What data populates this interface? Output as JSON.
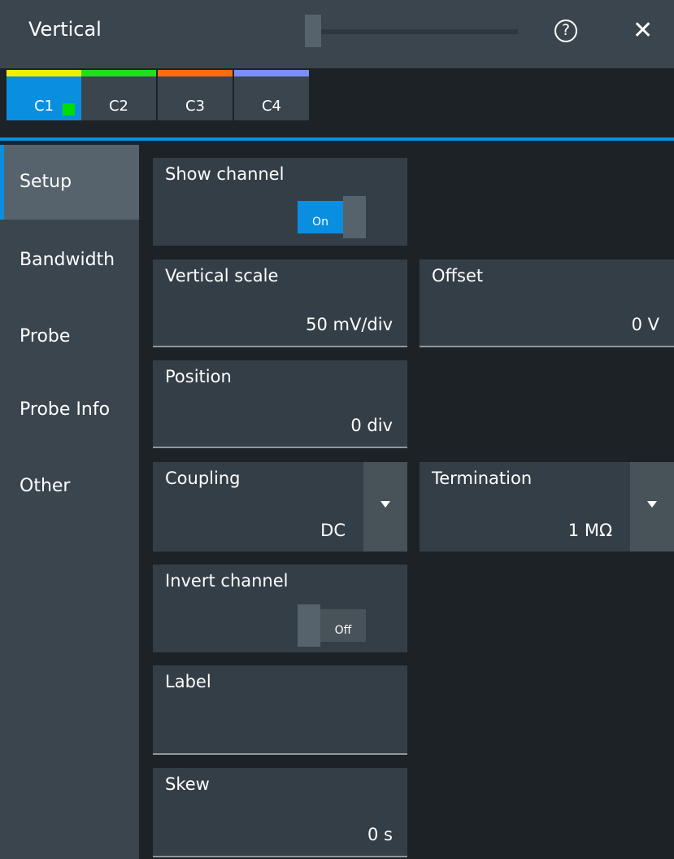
{
  "window": {
    "title": "Vertical",
    "help_glyph": "?",
    "close_glyph": "✕"
  },
  "tabs": [
    {
      "label": "C1",
      "color": "#f2ee00",
      "active": true
    },
    {
      "label": "C2",
      "color": "#22dd22"
    },
    {
      "label": "C3",
      "color": "#ff6a13"
    },
    {
      "label": "C4",
      "color": "#7a8fff"
    }
  ],
  "sidebar": {
    "items": [
      {
        "label": "Setup"
      },
      {
        "label": "Bandwidth"
      },
      {
        "label": "Probe"
      },
      {
        "label": "Probe Info"
      },
      {
        "label": "Other"
      }
    ]
  },
  "settings": {
    "show_channel": {
      "label": "Show channel",
      "state": "On"
    },
    "vertical_scale": {
      "label": "Vertical scale",
      "value": "50 mV/div"
    },
    "offset": {
      "label": "Offset",
      "value": "0 V"
    },
    "position": {
      "label": "Position",
      "value": "0 div"
    },
    "coupling": {
      "label": "Coupling",
      "value": "DC"
    },
    "termination": {
      "label": "Termination",
      "value": "1 MΩ"
    },
    "invert_channel": {
      "label": "Invert channel",
      "state": "Off"
    },
    "label": {
      "label": "Label",
      "value": ""
    },
    "skew": {
      "label": "Skew",
      "value": "0 s"
    }
  },
  "colors": {
    "accent": "#0a8fe0",
    "active_marker": "#00dd00"
  }
}
